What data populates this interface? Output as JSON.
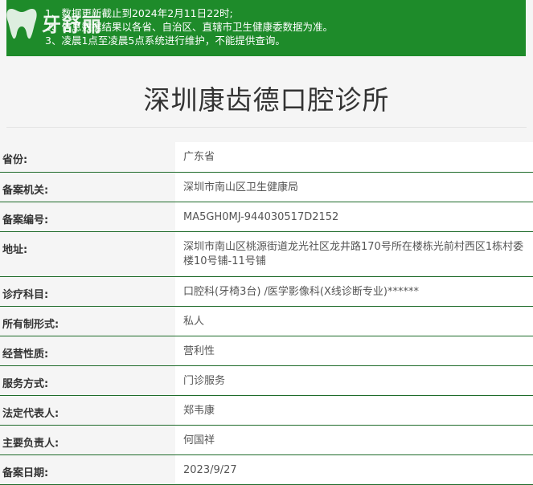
{
  "notice": {
    "lines": [
      "1、数据更新截止到2024年2月11日22时;",
      "2、信息数据结果以各省、自治区、直辖市卫生健康委数据为准。",
      "3、凌晨1点至凌晨5点系统进行维护，不能提供查询。"
    ]
  },
  "logo": {
    "text": "牙舒丽"
  },
  "page": {
    "title": "深圳康齿德口腔诊所"
  },
  "rows": [
    {
      "label": "省份:",
      "value": "广东省"
    },
    {
      "label": "备案机关:",
      "value": "深圳市南山区卫生健康局"
    },
    {
      "label": "备案编号:",
      "value": "MA5GH0MJ-944030517D2152"
    },
    {
      "label": "地址:",
      "value": "深圳市南山区桃源街道龙光社区龙井路170号所在楼栋光前村西区1栋村委楼10号铺-11号铺"
    },
    {
      "label": "诊疗科目:",
      "value": "口腔科(牙椅3台) /医学影像科(X线诊断专业)******"
    },
    {
      "label": "所有制形式:",
      "value": "私人"
    },
    {
      "label": "经营性质:",
      "value": "营利性"
    },
    {
      "label": "服务方式:",
      "value": "门诊服务"
    },
    {
      "label": "法定代表人:",
      "value": "郑韦康"
    },
    {
      "label": "主要负责人:",
      "value": "何国祥"
    },
    {
      "label": "备案日期:",
      "value": "2023/9/27"
    }
  ],
  "colors": {
    "notice_bg": "#1e8b2a",
    "row_border": "#1e6b2a"
  }
}
